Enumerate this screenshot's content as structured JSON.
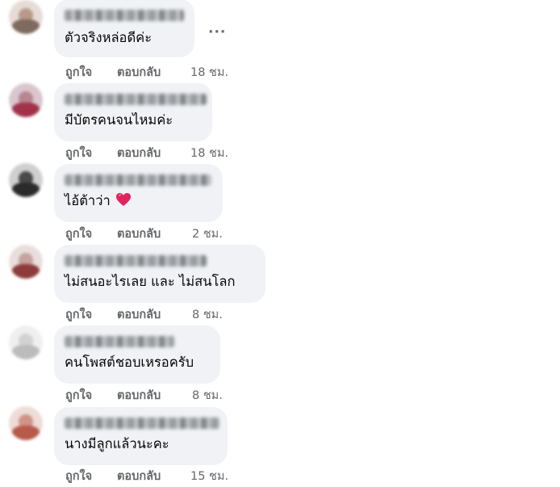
{
  "comments": [
    {
      "text": "ตัวจริงหล่อดีค่ะ",
      "like": "ถูกใจ",
      "reply": "ตอบกลับ",
      "time": "18 ชม.",
      "avatar_colors": [
        "#e6dcd6",
        "#b99a88",
        "#7e6a5e"
      ]
    },
    {
      "text": "มีบัตรคนจนไหมค่ะ",
      "like": "ถูกใจ",
      "reply": "ตอบกลับ",
      "time": "18 ชม.",
      "avatar_colors": [
        "#d9c6cf",
        "#b7868f",
        "#a2324a"
      ]
    },
    {
      "text": "ไอ้ต้าว่า",
      "like": "ถูกใจ",
      "reply": "ตอบกลับ",
      "time": "2 ชม.",
      "avatar_colors": [
        "#cfcfcf",
        "#4a4a4a",
        "#2b2b2b"
      ],
      "emoji": "red-heart"
    },
    {
      "text": "ไม่สนอะไรเลย และ ไม่สนโลก",
      "like": "ถูกใจ",
      "reply": "ตอบกลับ",
      "time": "8 ชม.",
      "avatar_colors": [
        "#eadedd",
        "#c4a3a0",
        "#8e3b3b"
      ]
    },
    {
      "text": "คนโพสต์ชอบเหรอครับ",
      "like": "ถูกใจ",
      "reply": "ตอบกลับ",
      "time": "8 ชม.",
      "avatar_colors": [
        "#efefef",
        "#d2d2d2",
        "#bcbcbc"
      ]
    },
    {
      "text": "นางมีลูกแล้วนะคะ",
      "like": "ถูกใจ",
      "reply": "ตอบกลับ",
      "time": "15 ชม.",
      "avatar_colors": [
        "#eddcd8",
        "#cf9486",
        "#b65a4a"
      ]
    }
  ],
  "more_icon": "ellipsis-icon",
  "colors": {
    "bubble": "#f0f2f5",
    "secondary_text": "#65676b",
    "heart": "#e0245e"
  }
}
